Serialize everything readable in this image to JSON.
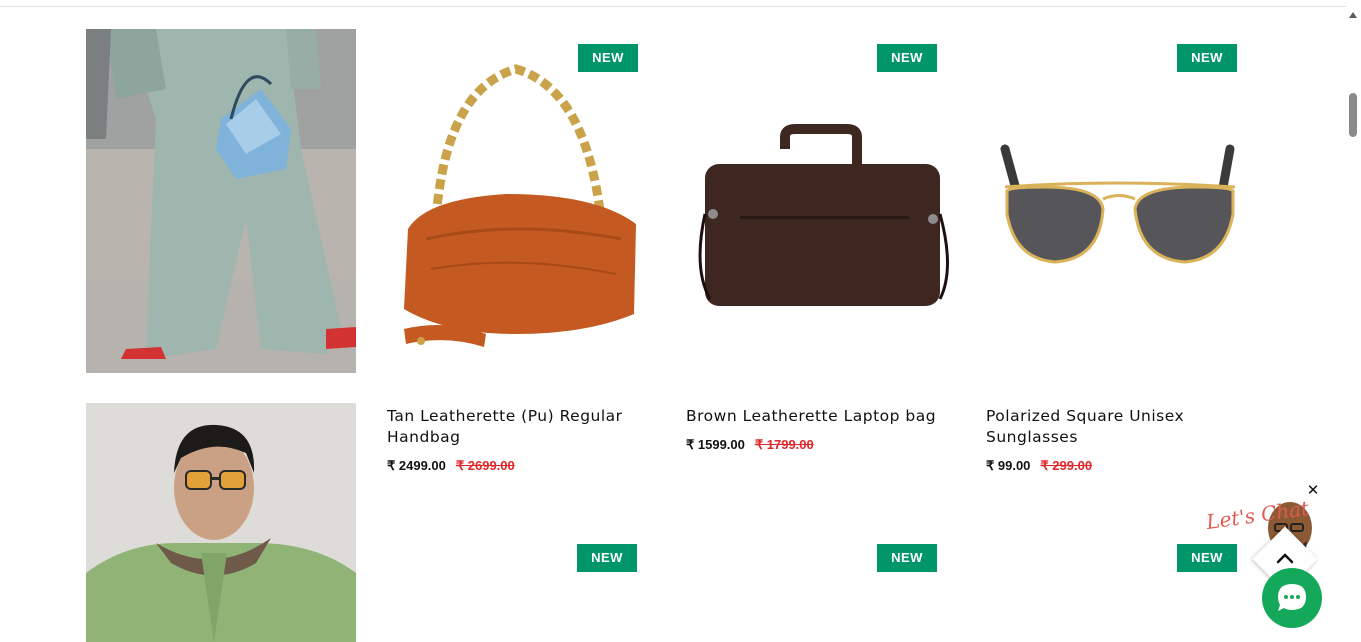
{
  "products": [
    {
      "badge": "NEW",
      "title": "Tan Leatherette (Pu) Regular Handbag",
      "price": "₹ 2499.00",
      "mrp": "₹ 2699.00"
    },
    {
      "badge": "NEW",
      "title": "Brown Leatherette Laptop bag",
      "price": "₹ 1599.00",
      "mrp": "₹ 1799.00"
    },
    {
      "badge": "NEW",
      "title": "Polarized Square Unisex Sunglasses",
      "price": "₹ 99.00",
      "mrp": "₹ 299.00"
    }
  ],
  "next_row_badges": [
    "NEW",
    "NEW",
    "NEW"
  ],
  "chat": {
    "art_text": "Let's Chat",
    "close_label": "✕"
  },
  "colors": {
    "badge": "#00966a",
    "mrp": "#e0262b",
    "chat_button": "#14a95a"
  }
}
